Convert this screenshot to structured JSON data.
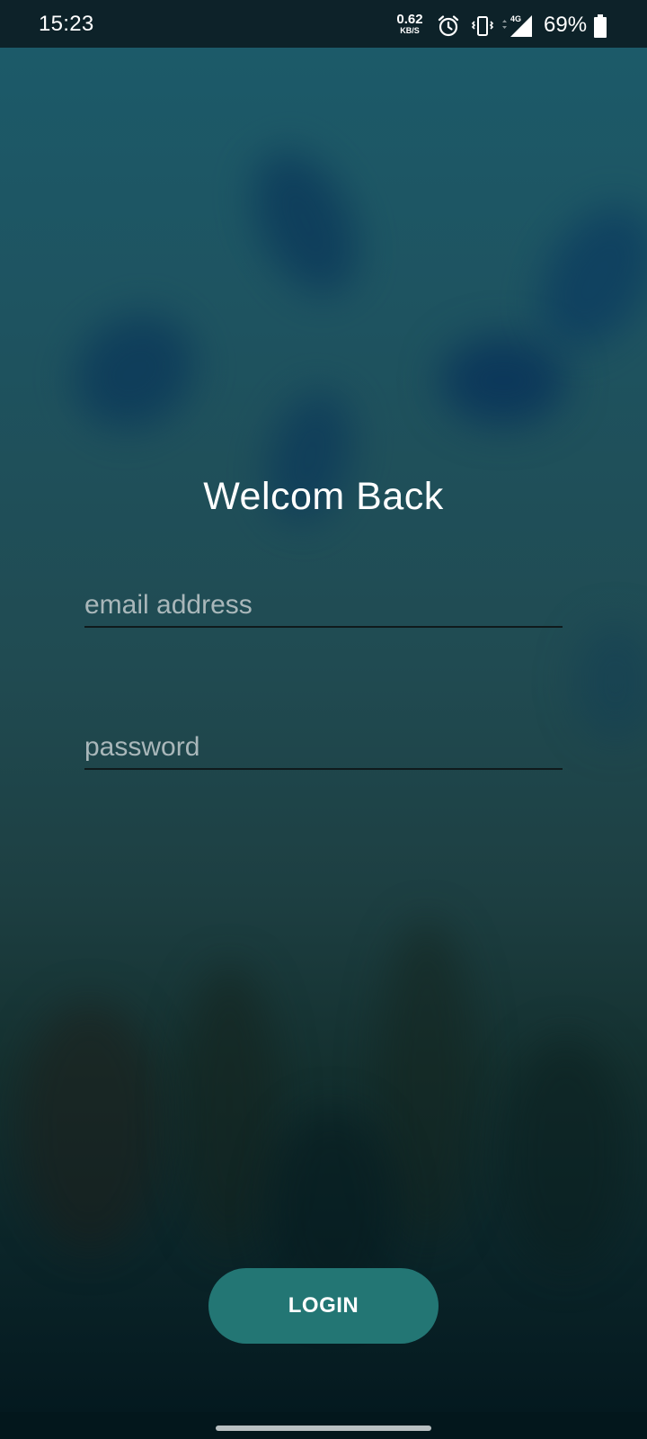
{
  "status_bar": {
    "time": "15:23",
    "net_speed_value": "0.62",
    "net_speed_unit": "KB/S",
    "network_type": "4G",
    "battery_percent": "69%",
    "icons": [
      "alarm-icon",
      "vibrate-icon",
      "signal-icon",
      "battery-icon"
    ]
  },
  "login": {
    "title": "Welcom Back",
    "email_placeholder": "email address",
    "email_value": "",
    "password_placeholder": "password",
    "password_value": "",
    "login_button_label": "LOGIN"
  },
  "colors": {
    "accent": "#237674",
    "status_bar_bg": "#0d2229",
    "text": "#ffffff"
  }
}
